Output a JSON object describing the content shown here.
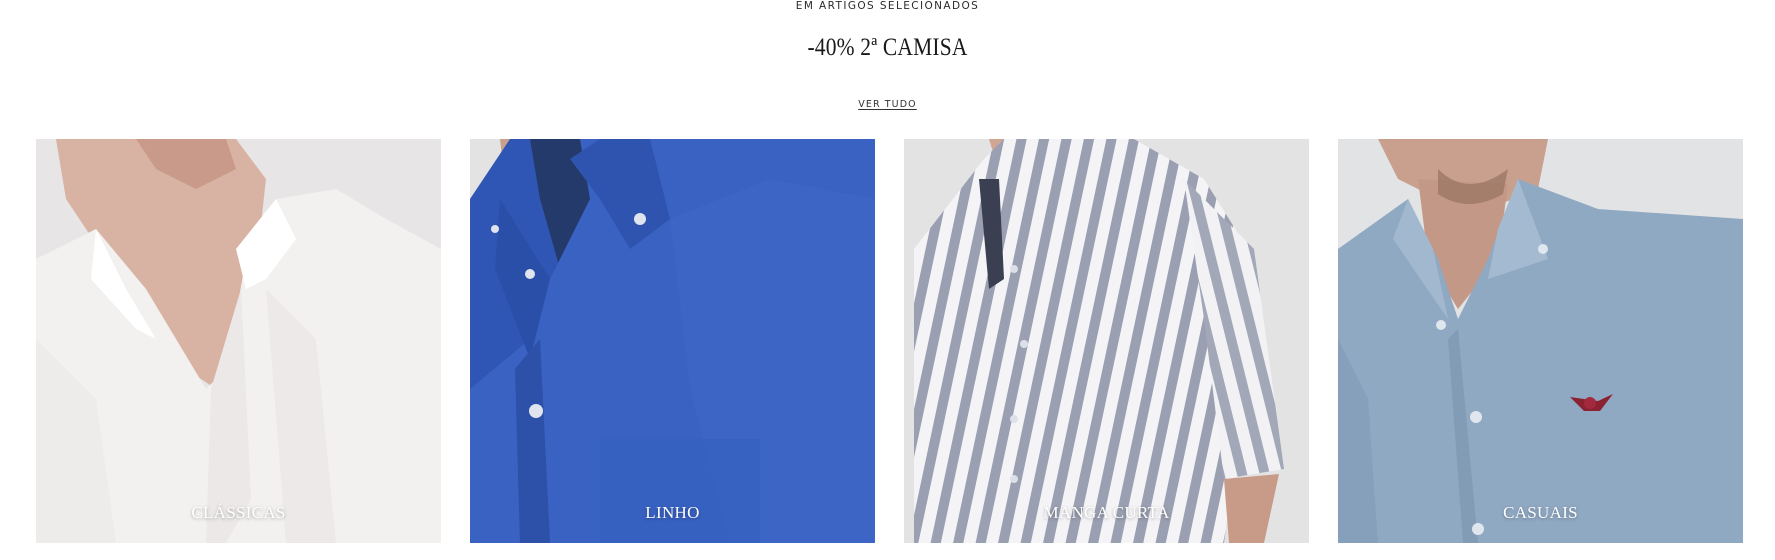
{
  "promo": {
    "eyebrow": "EM ARTIGOS SELECIONADOS",
    "title": "-40% 2ª CAMISA",
    "view_all": "VER TUDO"
  },
  "categories": [
    {
      "label": "CLÁSSICAS",
      "image": "white-dress-shirt",
      "background": "#e6e4e4"
    },
    {
      "label": "LINHO",
      "image": "blue-linen-shirt",
      "background": "#e2e2e2"
    },
    {
      "label": "MANGA CURTA",
      "image": "striped-short-sleeve-shirt",
      "background": "#e3e3e4"
    },
    {
      "label": "CASUAIS",
      "image": "light-blue-casual-shirt",
      "background": "#e1e2e3"
    }
  ]
}
